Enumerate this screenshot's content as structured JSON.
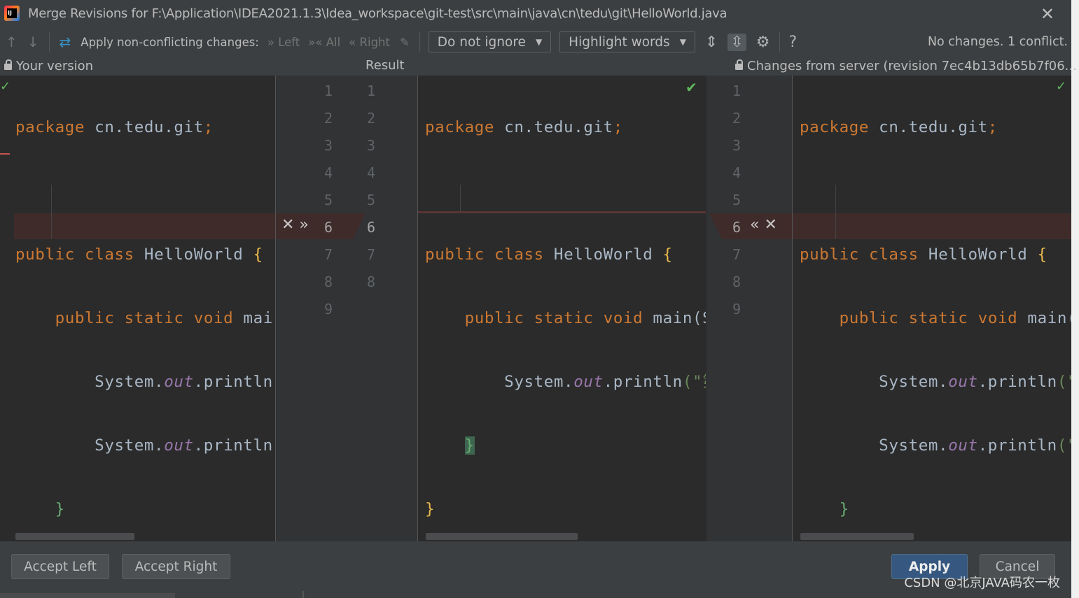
{
  "window": {
    "logo_text": "IJ",
    "title": "Merge Revisions for F:\\Application\\IDEA2021.1.3\\Idea_workspace\\git-test\\src\\main\\java\\cn\\tedu\\git\\HelloWorld.java",
    "close_glyph": "✕"
  },
  "toolbar": {
    "apply_label": "Apply non-conflicting changes:",
    "left_label": "Left",
    "all_label": "All",
    "right_label": "Right",
    "ignore_dropdown": "Do not ignore",
    "highlight_dropdown": "Highlight words",
    "help_glyph": "?",
    "status": "No changes. 1 conflict."
  },
  "headers": {
    "left": "Your version",
    "center": "Result",
    "right": "Changes from server (revision 7ec4b13db65b7f06..."
  },
  "code": {
    "package_kw": "package",
    "package_name": " cn.tedu.git",
    "semicolon": ";",
    "public_kw": "public",
    "class_kw": "class",
    "static_kw": "static",
    "void_kw": "void",
    "class_name": " HelloWorld ",
    "open_brace": "{",
    "close_brace": "}",
    "main_left": " mai",
    "main_mid": " main(S",
    "main_right": " main(",
    "system": "System.",
    "out": "out",
    "println": ".println",
    "println_mid_suffix": "(\"第",
    "println_right_suffix": "(\"",
    "println_right_suffix2": "(\""
  },
  "line_numbers": {
    "left_gutter": [
      "1",
      "2",
      "3",
      "4",
      "5",
      "6",
      "7",
      "8",
      "9"
    ],
    "result_gutter": [
      "1",
      "2",
      "3",
      "4",
      "5",
      "6",
      "7",
      "8"
    ],
    "right_gutter": [
      "1",
      "2",
      "3",
      "4",
      "5",
      "6",
      "7",
      "8",
      "9"
    ]
  },
  "conflict": {
    "left_icons": "✕ »",
    "right_icons": "« ✕"
  },
  "buttons": {
    "accept_left": "Accept Left",
    "accept_right": "Accept Right",
    "apply": "Apply",
    "cancel": "Cancel"
  },
  "watermark": "CSDN @北京JAVA码农一枚"
}
